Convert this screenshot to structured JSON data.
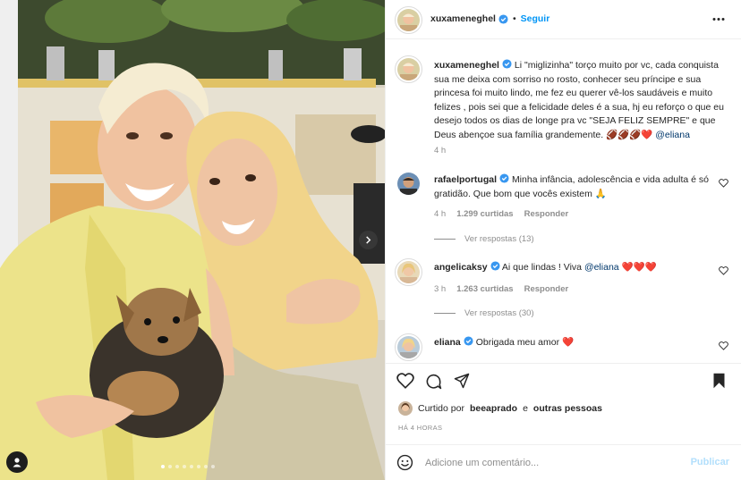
{
  "header": {
    "username": "xuxameneghel",
    "follow_label": "Seguir",
    "more_icon": "more-horizontal-icon"
  },
  "caption": {
    "username": "xuxameneghel",
    "text": "Li \"miglizinha\" torço muito por vc, cada conquista sua me deixa com sorriso no rosto, conhecer seu príncipe e sua princesa foi muito lindo, me fez eu querer vê-los saudáveis e muito felizes , pois sei que a felicidade deles é a sua, hj eu reforço o que eu desejo todos os dias de longe pra vc \"SEJA FELIZ SEMPRE\" e que Deus abençoe sua família grandemente. 🏈🏈🏈❤️",
    "mention": "@eliana",
    "age": "4 h"
  },
  "comments": [
    {
      "username": "rafaelportugal",
      "text": "Minha infância, adolescência e vida adulta é só gratidão. Que bom que vocês existem 🙏",
      "age": "4 h",
      "likes": "1.299 curtidas",
      "reply": "Responder",
      "view_replies": "Ver respostas (13)"
    },
    {
      "username": "angelicaksy",
      "text": "Ai que lindas ! Viva",
      "mention": "@eliana",
      "emoji": "❤️❤️❤️",
      "age": "3 h",
      "likes": "1.263 curtidas",
      "reply": "Responder",
      "view_replies": "Ver respostas (30)"
    },
    {
      "username": "eliana",
      "text": "Obrigada meu amor ❤️"
    }
  ],
  "likes": {
    "prefix": "Curtido por",
    "user": "beeaprado",
    "connector": "e",
    "others": "outras pessoas"
  },
  "post_time": "HÁ 4 HORAS",
  "add_comment": {
    "placeholder": "Adicione um comentário...",
    "publish_label": "Publicar"
  },
  "colors": {
    "accent": "#0095f6",
    "verified": "#3897f0",
    "heart_red": "#ed4956",
    "muted": "#8e8e8e"
  }
}
